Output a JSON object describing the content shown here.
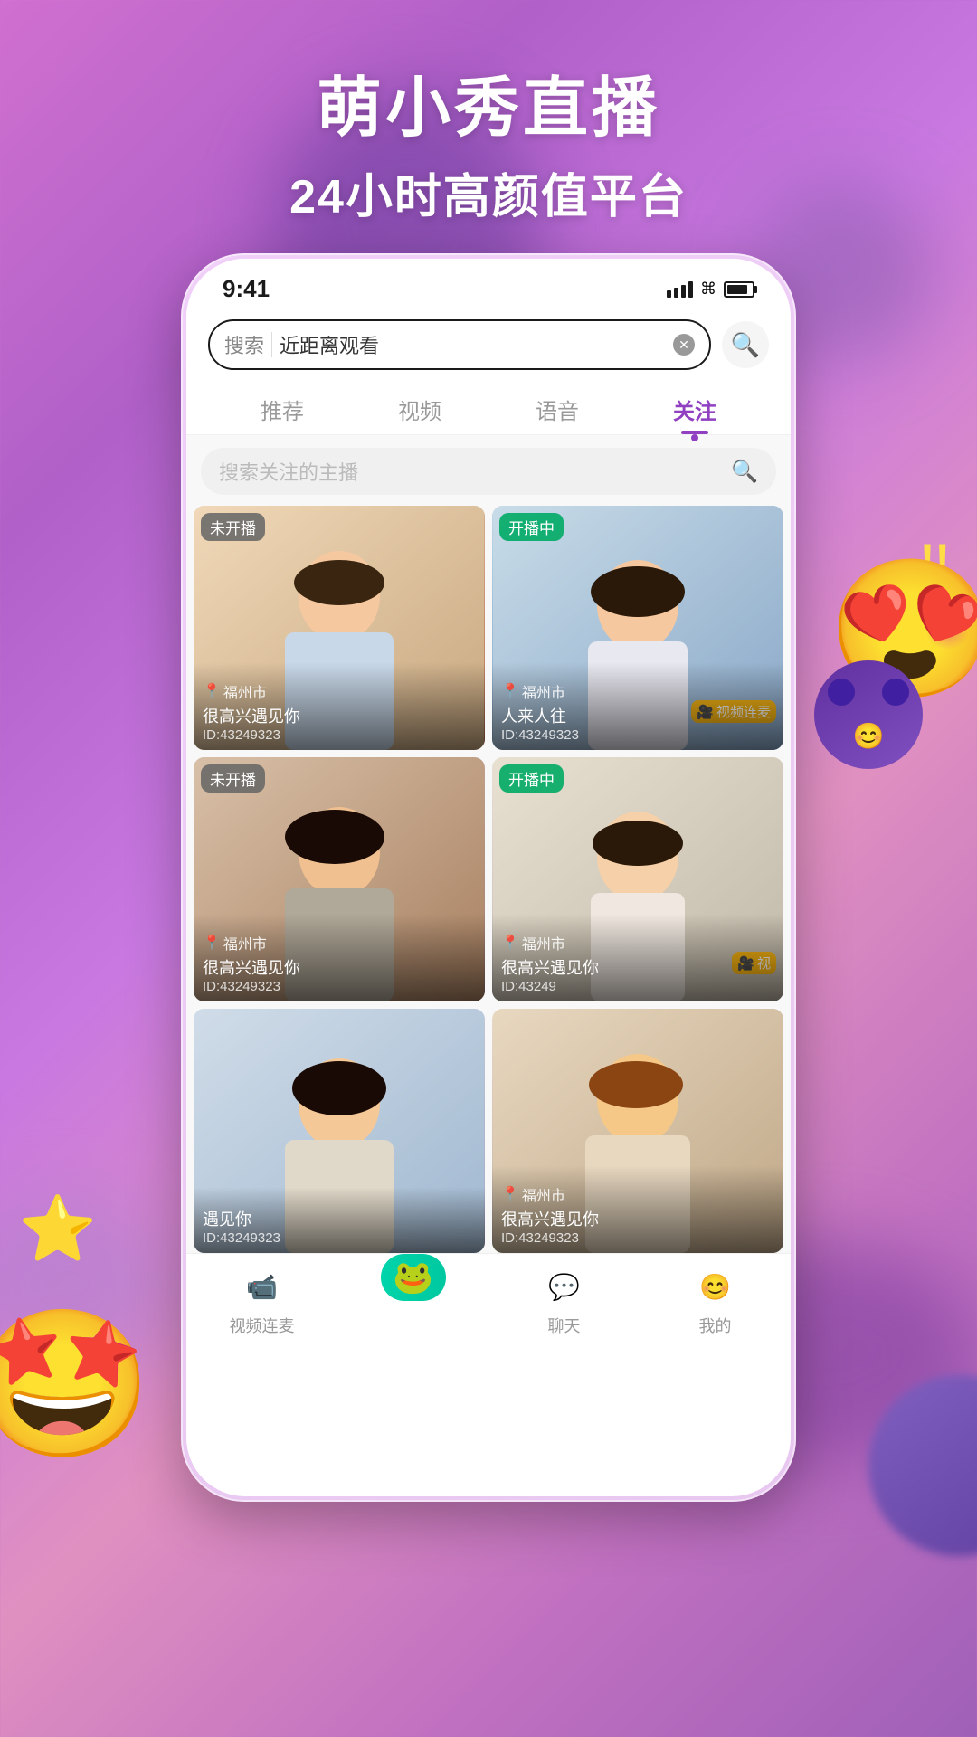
{
  "app": {
    "title": "萌小秀直播",
    "subtitle": "24小时高颜值平台"
  },
  "status_bar": {
    "time": "9:41",
    "signal": "▋▋▋",
    "wifi": "WiFi",
    "battery": "Battery"
  },
  "search": {
    "label": "搜索",
    "placeholder": "近距离观看",
    "clear_icon": "✕"
  },
  "tabs": [
    {
      "id": "recommend",
      "label": "推荐",
      "active": false
    },
    {
      "id": "video",
      "label": "视频",
      "active": false
    },
    {
      "id": "voice",
      "label": "语音",
      "active": false
    },
    {
      "id": "follow",
      "label": "关注",
      "active": true
    }
  ],
  "search_hosts": {
    "placeholder": "搜索关注的主播"
  },
  "cards": [
    {
      "id": 1,
      "badge": "未开播",
      "badge_type": "offline",
      "location": "福州市",
      "name": "很高兴遇见你",
      "user_id": "ID:43249323",
      "photo_class": "card-photo-1",
      "has_tag": false
    },
    {
      "id": 2,
      "badge": "开播中",
      "badge_type": "live",
      "location": "福州市",
      "name": "人来人往",
      "user_id": "ID:43249323",
      "photo_class": "card-photo-2",
      "has_tag": true,
      "tag": "视频连麦"
    },
    {
      "id": 3,
      "badge": "未开播",
      "badge_type": "offline",
      "location": "福州市",
      "name": "很高兴遇见你",
      "user_id": "ID:43249323",
      "photo_class": "card-photo-3",
      "has_tag": false
    },
    {
      "id": 4,
      "badge": "开播中",
      "badge_type": "live",
      "location": "福州市",
      "name": "很高兴遇见你",
      "user_id": "ID:43249",
      "photo_class": "card-photo-4",
      "has_tag": true,
      "tag": "视"
    },
    {
      "id": 5,
      "badge": "",
      "badge_type": "none",
      "location": "",
      "name": "遇见你",
      "user_id": "ID:43249323",
      "photo_class": "card-photo-5",
      "has_tag": false
    },
    {
      "id": 6,
      "badge": "",
      "badge_type": "none",
      "location": "福州市",
      "name": "很高兴遇见你",
      "user_id": "ID:43249323",
      "photo_class": "card-photo-6",
      "has_tag": false
    }
  ],
  "bottom_nav": [
    {
      "id": "video_link",
      "label": "视频连麦",
      "icon": "📹",
      "active": false
    },
    {
      "id": "home",
      "label": "",
      "icon": "🐸",
      "active": true,
      "is_center": true
    },
    {
      "id": "chat",
      "label": "聊天",
      "icon": "💬",
      "active": false
    },
    {
      "id": "me",
      "label": "我的",
      "icon": "😊",
      "active": false
    }
  ],
  "decorations": {
    "emoji_left": "😍",
    "emoji_right": "😍",
    "stars": "✨",
    "exclaim": "!!"
  }
}
